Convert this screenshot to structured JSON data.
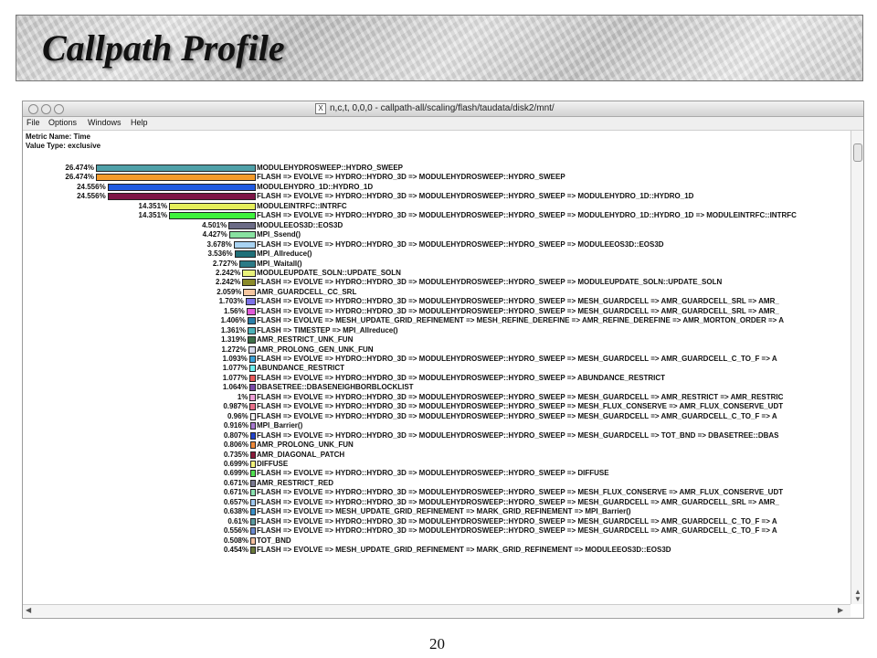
{
  "slide": {
    "title": "Callpath Profile",
    "page_number": "20"
  },
  "window": {
    "title": "n,c,t, 0,0,0 - callpath-all/scaling/flash/taudata/disk2/mnt/",
    "menu": [
      "File",
      "Options",
      "Windows",
      "Help"
    ],
    "metric_name": "Metric Name: Time",
    "value_type": "Value Type: exclusive"
  },
  "profile": {
    "max_percent": 26.474,
    "rows": [
      {
        "pct": "26.474%",
        "value": 26.474,
        "color": "#4fa0a8",
        "name": "MODULEHYDROSWEEP::HYDRO_SWEEP"
      },
      {
        "pct": "26.474%",
        "value": 26.474,
        "color": "#f59b2a",
        "name": "FLASH   => EVOLVE   => HYDRO::HYDRO_3D    => MODULEHYDROSWEEP::HYDRO_SWEEP"
      },
      {
        "pct": "24.556%",
        "value": 24.556,
        "color": "#1f5ae0",
        "name": "MODULEHYDRO_1D::HYDRO_1D"
      },
      {
        "pct": "24.556%",
        "value": 24.556,
        "color": "#7d1646",
        "name": "FLASH   => EVOLVE   => HYDRO::HYDRO_3D    => MODULEHYDROSWEEP::HYDRO_SWEEP    => MODULEHYDRO_1D::HYDRO_1D"
      },
      {
        "pct": "14.351%",
        "value": 14.351,
        "color": "#e5ef5a",
        "name": "MODULEINTRFC::INTRFC"
      },
      {
        "pct": "14.351%",
        "value": 14.351,
        "color": "#3ef23c",
        "name": "FLASH   => EVOLVE   => HYDRO::HYDRO_3D    => MODULEHYDROSWEEP::HYDRO_SWEEP    => MODULEHYDRO_1D::HYDRO_1D    => MODULEINTRFC::INTRFC"
      },
      {
        "pct": "4.501%",
        "value": 4.501,
        "color": "#6b6b86",
        "name": "MODULEEOS3D::EOS3D"
      },
      {
        "pct": "4.427%",
        "value": 4.427,
        "color": "#88e2a0",
        "name": "MPI_Ssend()"
      },
      {
        "pct": "3.678%",
        "value": 3.678,
        "color": "#a9d3f2",
        "name": "FLASH   => EVOLVE   => HYDRO::HYDRO_3D    => MODULEHYDROSWEEP::HYDRO_SWEEP    => MODULEEOS3D::EOS3D"
      },
      {
        "pct": "3.536%",
        "value": 3.536,
        "color": "#1f6f78",
        "name": "MPI_Allreduce()"
      },
      {
        "pct": "2.727%",
        "value": 2.727,
        "color": "#2c7a86",
        "name": "MPI_Waitall()"
      },
      {
        "pct": "2.242%",
        "value": 2.242,
        "color": "#e8f27a",
        "name": "MODULEUPDATE_SOLN::UPDATE_SOLN"
      },
      {
        "pct": "2.242%",
        "value": 2.242,
        "color": "#8a8a2a",
        "name": "FLASH   => EVOLVE   => HYDRO::HYDRO_3D    => MODULEHYDROSWEEP::HYDRO_SWEEP    => MODULEUPDATE_SOLN::UPDATE_SOLN"
      },
      {
        "pct": "2.059%",
        "value": 2.059,
        "color": "#f5c6a0",
        "name": "AMR_GUARDCELL_CC_SRL"
      },
      {
        "pct": "1.703%",
        "value": 1.703,
        "color": "#7c72e8",
        "name": "FLASH   => EVOLVE   => HYDRO::HYDRO_3D    => MODULEHYDROSWEEP::HYDRO_SWEEP    => MESH_GUARDCELL    => AMR_GUARDCELL_SRL    => AMR_"
      },
      {
        "pct": "1.56%",
        "value": 1.56,
        "color": "#e05bd8",
        "name": "FLASH   => EVOLVE   => HYDRO::HYDRO_3D    => MODULEHYDROSWEEP::HYDRO_SWEEP    => MESH_GUARDCELL    => AMR_GUARDCELL_SRL    => AMR_"
      },
      {
        "pct": "1.406%",
        "value": 1.406,
        "color": "#2a7fa8",
        "name": "FLASH   => EVOLVE   => MESH_UPDATE_GRID_REFINEMENT    => MESH_REFINE_DEREFINE   => AMR_REFINE_DEREFINE    => AMR_MORTON_ORDER    => A"
      },
      {
        "pct": "1.361%",
        "value": 1.361,
        "color": "#4cb2b8",
        "name": "FLASH   => TIMESTEP    => MPI_Allreduce()"
      },
      {
        "pct": "1.319%",
        "value": 1.319,
        "color": "#3f6f4a",
        "name": "AMR_RESTRICT_UNK_FUN"
      },
      {
        "pct": "1.272%",
        "value": 1.272,
        "color": "#d6d8ea",
        "name": "AMR_PROLONG_GEN_UNK_FUN"
      },
      {
        "pct": "1.093%",
        "value": 1.093,
        "color": "#3aa0d8",
        "name": "FLASH   => EVOLVE   => HYDRO::HYDRO_3D    => MODULEHYDROSWEEP::HYDRO_SWEEP    => MESH_GUARDCELL    => AMR_GUARDCELL_C_TO_F    => A"
      },
      {
        "pct": "1.077%",
        "value": 1.077,
        "color": "#6ff0f0",
        "name": "ABUNDANCE_RESTRICT"
      },
      {
        "pct": "1.077%",
        "value": 1.077,
        "color": "#e85a5a",
        "name": "FLASH   => EVOLVE   => HYDRO::HYDRO_3D    => MODULEHYDROSWEEP::HYDRO_SWEEP    => ABUNDANCE_RESTRICT"
      },
      {
        "pct": "1.064%",
        "value": 1.064,
        "color": "#7a4aa8",
        "name": "DBASETREE::DBASENEIGHBORBLOCKLIST"
      },
      {
        "pct": "1%",
        "value": 1.0,
        "color": "#f0a0d8",
        "name": "FLASH   => EVOLVE   => HYDRO::HYDRO_3D    => MODULEHYDROSWEEP::HYDRO_SWEEP    => MESH_GUARDCELL    => AMR_RESTRICT    => AMR_RESTRIC"
      },
      {
        "pct": "0.987%",
        "value": 0.987,
        "color": "#e8708a",
        "name": "FLASH   => EVOLVE   => HYDRO::HYDRO_3D    => MODULEHYDROSWEEP::HYDRO_SWEEP    => MESH_FLUX_CONSERVE    => AMR_FLUX_CONSERVE_UDT"
      },
      {
        "pct": "0.96%",
        "value": 0.96,
        "color": "#f2f2f2",
        "name": "FLASH   => EVOLVE   => HYDRO::HYDRO_3D    => MODULEHYDROSWEEP::HYDRO_SWEEP    => MESH_GUARDCELL    => AMR_GUARDCELL_C_TO_F    => A"
      },
      {
        "pct": "0.916%",
        "value": 0.916,
        "color": "#a878d0",
        "name": "MPI_Barrier()"
      },
      {
        "pct": "0.807%",
        "value": 0.807,
        "color": "#2244cc",
        "name": "FLASH   => EVOLVE   => HYDRO::HYDRO_3D    => MODULEHYDROSWEEP::HYDRO_SWEEP    => MESH_GUARDCELL    => TOT_BND    => DBASETREE::DBAS"
      },
      {
        "pct": "0.806%",
        "value": 0.806,
        "color": "#f08a3a",
        "name": "AMR_PROLONG_UNK_FUN"
      },
      {
        "pct": "0.735%",
        "value": 0.735,
        "color": "#8a1a3a",
        "name": "AMR_DIAGONAL_PATCH"
      },
      {
        "pct": "0.699%",
        "value": 0.699,
        "color": "#f2f27a",
        "name": "DIFFUSE"
      },
      {
        "pct": "0.699%",
        "value": 0.699,
        "color": "#50e050",
        "name": "FLASH   => EVOLVE   => HYDRO::HYDRO_3D    => MODULEHYDROSWEEP::HYDRO_SWEEP    => DIFFUSE"
      },
      {
        "pct": "0.671%",
        "value": 0.671,
        "color": "#7a7a92",
        "name": "AMR_RESTRICT_RED"
      },
      {
        "pct": "0.671%",
        "value": 0.671,
        "color": "#8ae2b0",
        "name": "FLASH   => EVOLVE   => HYDRO::HYDRO_3D    => MODULEHYDROSWEEP::HYDRO_SWEEP    => MESH_FLUX_CONSERVE    => AMR_FLUX_CONSERVE_UDT"
      },
      {
        "pct": "0.657%",
        "value": 0.657,
        "color": "#a0c8f0",
        "name": "FLASH   => EVOLVE   => HYDRO::HYDRO_3D    => MODULEHYDROSWEEP::HYDRO_SWEEP    => MESH_GUARDCELL    => AMR_GUARDCELL_SRL    => AMR_"
      },
      {
        "pct": "0.638%",
        "value": 0.638,
        "color": "#3a90c8",
        "name": "FLASH   => EVOLVE   => MESH_UPDATE_GRID_REFINEMENT    => MARK_GRID_REFINEMENT    => MPI_Barrier()"
      },
      {
        "pct": "0.61%",
        "value": 0.61,
        "color": "#5a9aa0",
        "name": "FLASH   => EVOLVE   => HYDRO::HYDRO_3D    => MODULEHYDROSWEEP::HYDRO_SWEEP    => MESH_GUARDCELL    => AMR_GUARDCELL_C_TO_F    => A"
      },
      {
        "pct": "0.556%",
        "value": 0.556,
        "color": "#6a8ad0",
        "name": "FLASH   => EVOLVE   => HYDRO::HYDRO_3D    => MODULEHYDROSWEEP::HYDRO_SWEEP    => MESH_GUARDCELL    => AMR_GUARDCELL_C_TO_F    => A"
      },
      {
        "pct": "0.508%",
        "value": 0.508,
        "color": "#f4c0a0",
        "name": "TOT_BND"
      },
      {
        "pct": "0.454%",
        "value": 0.454,
        "color": "#6a7a3a",
        "name": "FLASH   => EVOLVE   => MESH_UPDATE_GRID_REFINEMENT    => MARK_GRID_REFINEMENT    => MODULEEOS3D::EOS3D"
      }
    ]
  }
}
